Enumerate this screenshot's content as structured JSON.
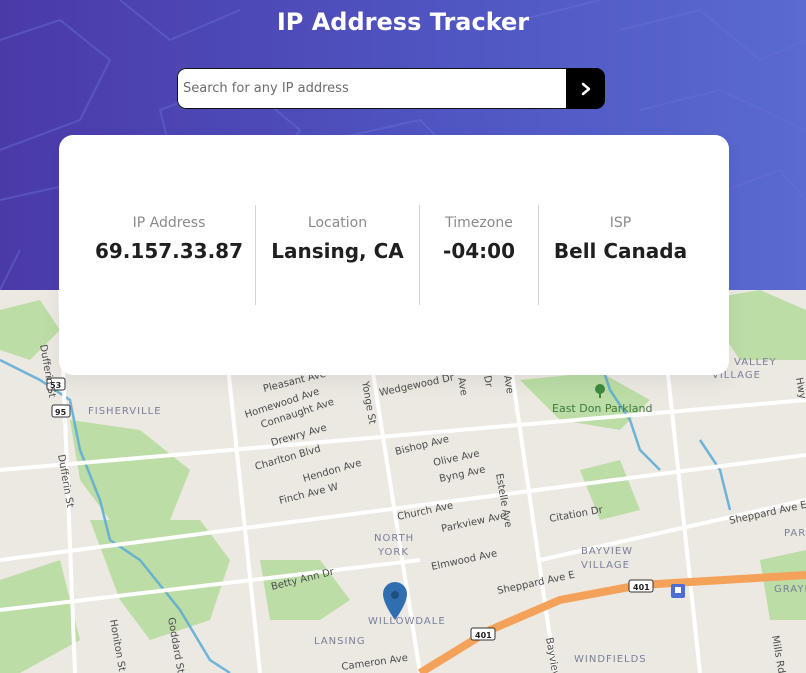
{
  "header": {
    "title": "IP Address Tracker",
    "search": {
      "placeholder": "Search for any IP address",
      "value": ""
    },
    "submit_icon": "chevron-right-icon"
  },
  "info": [
    {
      "label": "IP Address",
      "value": "69.157.33.87"
    },
    {
      "label": "Location",
      "value": "Lansing, CA"
    },
    {
      "label": "Timezone",
      "value": "-04:00"
    },
    {
      "label": "ISP",
      "value": "Bell Canada"
    }
  ],
  "map": {
    "marker_icon": "location-pin-icon",
    "streets": [
      "Dufferin St",
      "Pleasant Ave",
      "Homewood Ave",
      "Connaught Ave",
      "Drewry Ave",
      "Charlton Blvd",
      "Hendon Ave",
      "Finch Ave W",
      "Wedgewood Dr",
      "Yonge St",
      "Bishop Ave",
      "Olive Ave",
      "Byng Ave",
      "Church Ave",
      "Parkview Ave",
      "Estelle Ave",
      "Elmwood Ave",
      "Betty Ann Dr",
      "Sheppard Ave E",
      "Citation Dr",
      "Honiton St",
      "Goddard St",
      "Cameron Ave",
      "Bayview",
      "Mills Rd",
      "Hwy",
      "Dr",
      "Ave"
    ],
    "areas": [
      "FISHERVILLE",
      "NORTH",
      "YORK",
      "BAYVIEW",
      "VILLAGE",
      "VALLEY",
      "WILLOWDALE",
      "LANSING",
      "WINDFIELDS",
      "PARK",
      "GRAYD"
    ],
    "parks": [
      "East Don Parkland"
    ],
    "route_shields": [
      "53",
      "95",
      "401",
      "401"
    ],
    "colors": {
      "highway": "#f4a259",
      "water": "#5aa9d6",
      "park": "#b7dca0",
      "land": "#ece9e2"
    }
  },
  "colors": {
    "hero_start": "#4a3aa8",
    "hero_end": "#5a6ad0",
    "card": "#ffffff",
    "button": "#000000"
  }
}
